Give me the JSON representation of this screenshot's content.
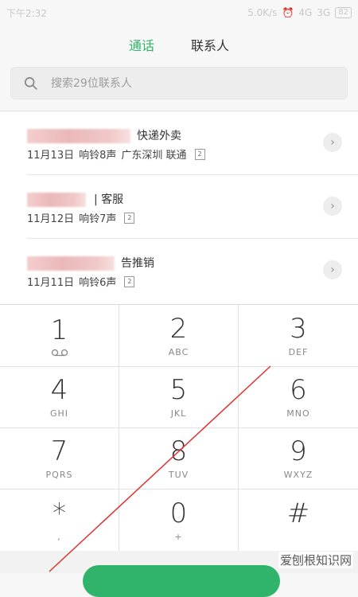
{
  "status_bar": {
    "time": "下午2:32",
    "speed": "5.0K/s",
    "network1": "4G",
    "network2": "3G",
    "battery": "82"
  },
  "tabs": [
    {
      "label": "通话",
      "active": true
    },
    {
      "label": "联系人",
      "active": false
    }
  ],
  "search": {
    "placeholder": "搜索29位联系人"
  },
  "call_log": [
    {
      "name": "快递外卖",
      "date": "11月13日",
      "rings": "响铃8声",
      "location": "广东深圳 联通",
      "count": "2"
    },
    {
      "name": "| 客服",
      "date": "11月12日",
      "rings": "响铃7声",
      "location": "",
      "count": "2"
    },
    {
      "name": "告推销",
      "date": "11月11日",
      "rings": "响铃6声",
      "location": "",
      "count": "2"
    }
  ],
  "keypad": [
    {
      "digit": "1",
      "letters": ""
    },
    {
      "digit": "2",
      "letters": "ABC"
    },
    {
      "digit": "3",
      "letters": "DEF"
    },
    {
      "digit": "4",
      "letters": "GHI"
    },
    {
      "digit": "5",
      "letters": "JKL"
    },
    {
      "digit": "6",
      "letters": "MNO"
    },
    {
      "digit": "7",
      "letters": "PQRS"
    },
    {
      "digit": "8",
      "letters": "TUV"
    },
    {
      "digit": "9",
      "letters": "WXYZ"
    },
    {
      "digit": "*",
      "letters": ","
    },
    {
      "digit": "0",
      "letters": "+"
    },
    {
      "digit": "#",
      "letters": ""
    }
  ],
  "watermark": "爱刨根知识网",
  "colors": {
    "accent": "#31b36b",
    "annotation_line": "#e03030"
  }
}
